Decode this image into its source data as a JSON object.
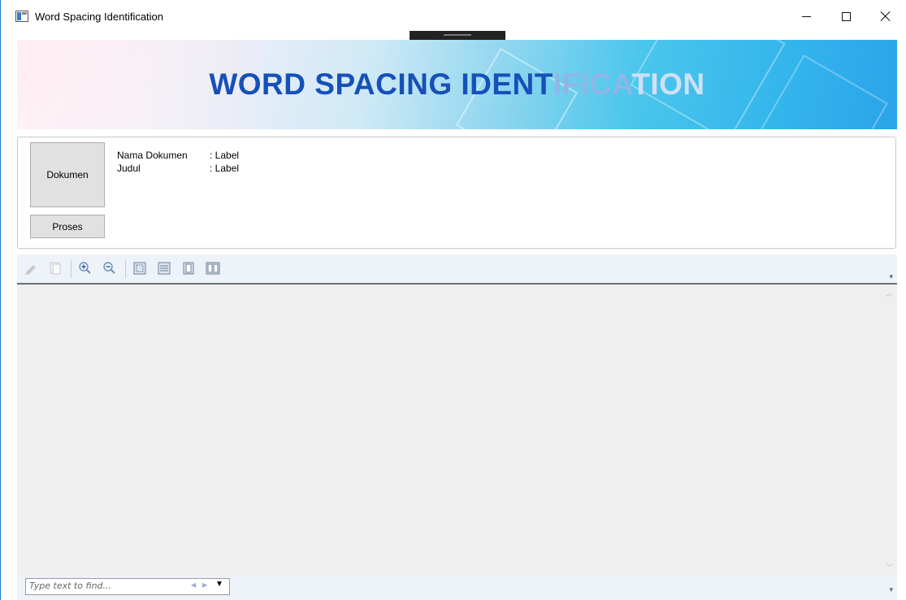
{
  "window": {
    "title": "Word Spacing Identification"
  },
  "banner": {
    "title_dark": "WORD SPACING IDENT",
    "title_faded": "IFICA",
    "title_end": "TION",
    "colors": {
      "title": "#1650b8",
      "accent": "#2aa4ea"
    }
  },
  "panel": {
    "dokumen_button": "Dokumen",
    "proses_button": "Proses",
    "fields": [
      {
        "label": "Nama Dokumen",
        "value": ": Label"
      },
      {
        "label": "Judul",
        "value": ": Label"
      }
    ]
  },
  "toolbar": {
    "icons": [
      "print-icon",
      "copy-icon",
      "zoom-in-icon",
      "zoom-out-icon",
      "actual-size-icon",
      "page-width-icon",
      "whole-page-icon",
      "two-pages-icon"
    ]
  },
  "findbar": {
    "placeholder": "Type text to find..."
  }
}
